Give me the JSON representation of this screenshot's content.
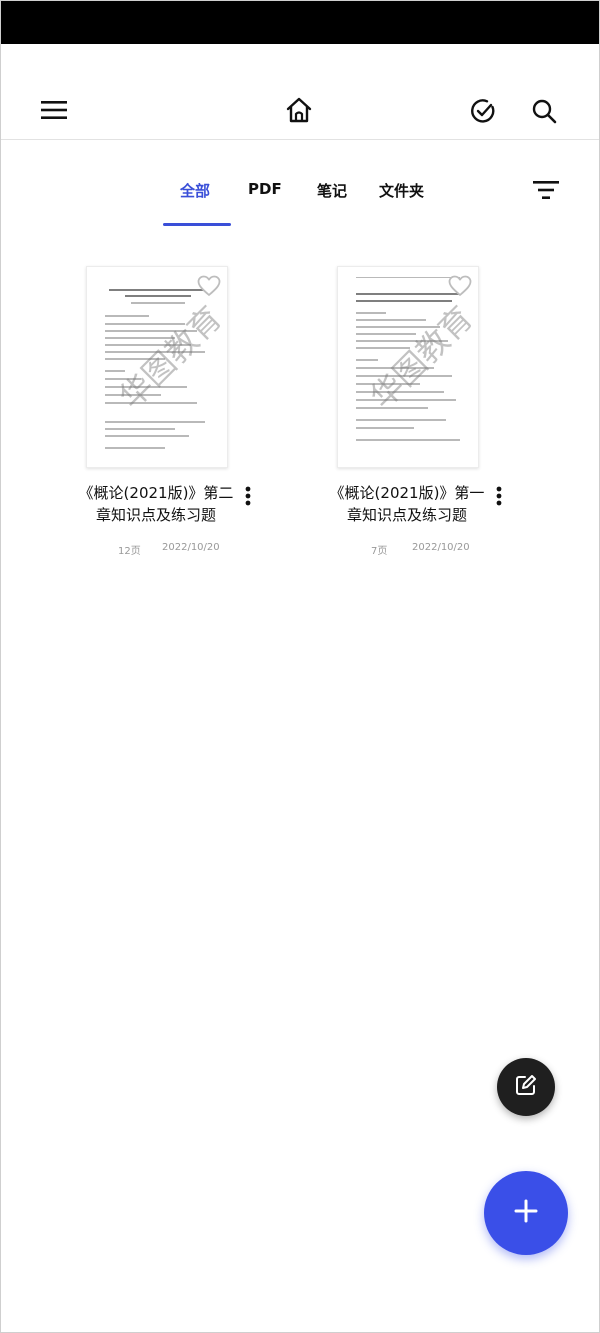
{
  "toolbar": {
    "menu_icon": "hamburger-menu-icon",
    "home_icon": "home-icon",
    "check_icon": "check-circle-icon",
    "search_icon": "search-icon"
  },
  "tabs": [
    {
      "label": "全部",
      "active": true
    },
    {
      "label": "PDF",
      "active": false
    },
    {
      "label": "笔记",
      "active": false
    },
    {
      "label": "文件夹",
      "active": false
    }
  ],
  "filter_icon": "filter-sort-icon",
  "documents": [
    {
      "title": "《概论(2021版)》第二章知识点及练习题",
      "pages": "12页",
      "date": "2022/10/20",
      "watermark": "华图教育",
      "favorite_icon": "heart-outline-icon",
      "more_icon": "more-vertical-icon"
    },
    {
      "title": "《概论(2021版)》第一章知识点及练习题",
      "pages": "7页",
      "date": "2022/10/20",
      "watermark": "华图教育",
      "favorite_icon": "heart-outline-icon",
      "more_icon": "more-vertical-icon"
    }
  ],
  "fab": {
    "note_icon": "edit-note-icon",
    "add_icon": "plus-icon"
  },
  "colors": {
    "accent": "#3a4fe8",
    "tab_active": "#3a4fd8",
    "fab_dark": "#1f1f1f",
    "status_bar": "#000000"
  }
}
